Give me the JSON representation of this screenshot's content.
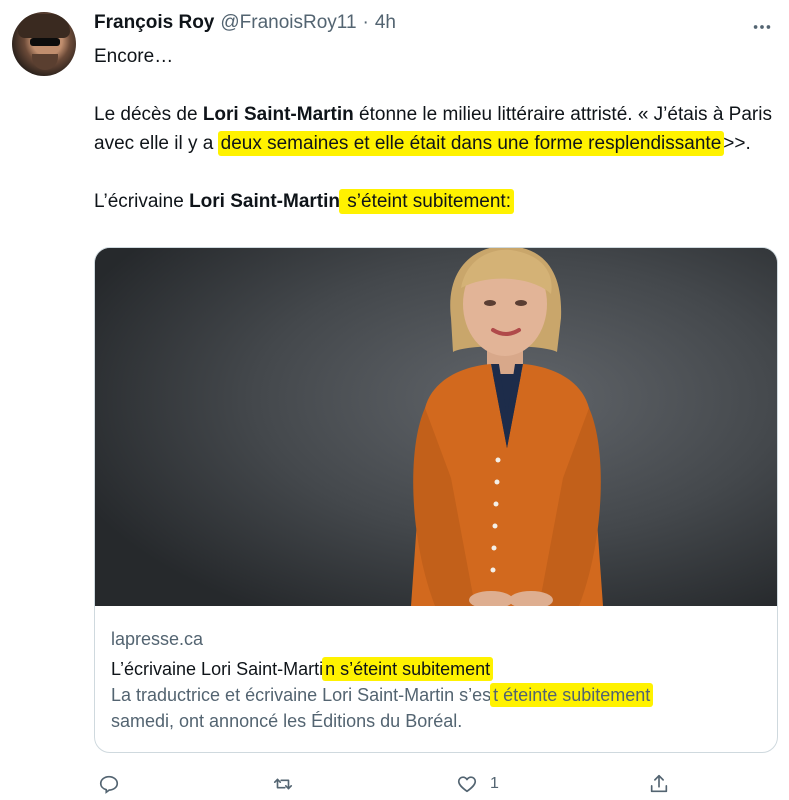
{
  "tweet": {
    "author_name": "François Roy",
    "author_handle": "@FranoisRoy11",
    "separator": "·",
    "time": "4h",
    "line1": "Encore…",
    "p2": {
      "a": "Le décès de ",
      "b_bold": "Lori Saint-Martin",
      "c": " étonne le milieu littéraire attristé. « J’étais à Paris avec elle il y a ",
      "d_highlight": "deux semaines et elle était dans une forme resplendissante",
      "e": ">>."
    },
    "p3": {
      "a": "L’écrivaine ",
      "b_bold": "Lori Saint-Martin",
      "c_highlight": " s’éteint subitement:"
    }
  },
  "card": {
    "domain": "lapresse.ca",
    "title_a": "L’écrivaine Lori Saint-Marti",
    "title_highlight": "n s’éteint subitement",
    "desc_a": "La traductrice et écrivaine Lori Saint-Martin s’es",
    "desc_highlight": "t éteinte subitement",
    "desc_b": "samedi, ont annoncé les Éditions du Boréal."
  },
  "actions": {
    "reply_count": "",
    "retweet_count": "",
    "like_count": "1"
  },
  "colors": {
    "highlight": "#fff200",
    "secondary_text": "#536471",
    "border": "#cfd9de",
    "cardigan": "#d2691e"
  },
  "icons": [
    "more-icon",
    "reply-icon",
    "retweet-icon",
    "like-icon",
    "share-icon"
  ]
}
